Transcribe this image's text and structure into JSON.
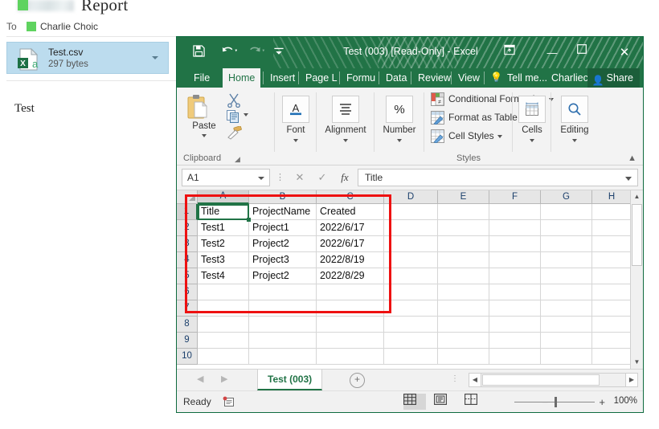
{
  "mail": {
    "subject": "Report",
    "to_label": "To",
    "recipient": "Charlie Choic",
    "attachment": {
      "name": "Test.csv",
      "size": "297 bytes",
      "icon": "excel-csv-file-icon"
    },
    "body": "Test"
  },
  "excel": {
    "title": "Test (003)  [Read-Only] - Excel",
    "quick_access": [
      {
        "name": "save",
        "glyph": "💾"
      },
      {
        "name": "undo",
        "glyph": "↶"
      },
      {
        "name": "redo",
        "glyph": "↷"
      },
      {
        "name": "customize-quick-access-toolbar",
        "glyph": "☰"
      }
    ],
    "window_buttons": {
      "ribbon_display": "⬛",
      "minimize": "—",
      "maximize": "☐",
      "close": "✕"
    },
    "tabs": [
      {
        "label": "File",
        "active": false
      },
      {
        "label": "Home",
        "active": true
      },
      {
        "label": "Insert",
        "active": false
      },
      {
        "label": "Page L",
        "active": false
      },
      {
        "label": "Formu",
        "active": false
      },
      {
        "label": "Data",
        "active": false
      },
      {
        "label": "Review",
        "active": false
      },
      {
        "label": "View",
        "active": false
      }
    ],
    "tell_me": "Tell me...",
    "user": "Charliech...",
    "share": "Share",
    "ribbon": {
      "groups": [
        {
          "name": "Clipboard",
          "label": "Clipboard"
        },
        {
          "name": "Font",
          "label": ""
        },
        {
          "name": "Alignment",
          "label": ""
        },
        {
          "name": "Number",
          "label": ""
        },
        {
          "name": "Styles",
          "label": "Styles"
        },
        {
          "name": "Cells",
          "label": ""
        },
        {
          "name": "Editing",
          "label": ""
        }
      ],
      "paste": "Paste",
      "cut_icon": "scissors-icon",
      "copy_icon": "copy-icon",
      "format_painter_icon": "format-painter-icon",
      "font": "Font",
      "alignment": "Alignment",
      "number": "Number",
      "number_symbol": "%",
      "font_symbol": "A",
      "styles": {
        "conditional_formatting": "Conditional Formatting",
        "format_as_table": "Format as Table",
        "cell_styles": "Cell Styles",
        "group_label": "Styles"
      },
      "cells": "Cells",
      "editing": "Editing",
      "collapse_icon": "chevron-up-icon"
    },
    "formula_bar": {
      "name_box": "A1",
      "cancel_icon": "✕",
      "enter_icon": "✓",
      "function_icon": "fx",
      "value": "Title"
    },
    "grid": {
      "columns": [
        "A",
        "B",
        "C",
        "D",
        "E",
        "F",
        "G",
        "H"
      ],
      "rows": [
        "1",
        "2",
        "3",
        "4",
        "5",
        "6",
        "7",
        "8",
        "9",
        "10"
      ],
      "selected_cell": "A1",
      "data": [
        [
          "Title",
          "ProjectName",
          "Created"
        ],
        [
          "Test1",
          "Project1",
          "2022/6/17"
        ],
        [
          "Test2",
          "Project2",
          "2022/6/17"
        ],
        [
          "Test3",
          "Project3",
          "2022/8/19"
        ],
        [
          "Test4",
          "Project2",
          "2022/8/29"
        ]
      ]
    },
    "sheet_tabs": {
      "first_arrow": "◀",
      "last_arrow": "▶",
      "tabs": [
        {
          "label": "Test (003)",
          "active": true
        }
      ],
      "add_label": "+"
    },
    "status_bar": {
      "status": "Ready",
      "macro_icon": "record-macro-icon",
      "views": [
        {
          "name": "normal-view",
          "glyph": "▦",
          "active": true
        },
        {
          "name": "page-layout-view",
          "glyph": "▤",
          "active": false
        },
        {
          "name": "page-break-preview",
          "glyph": "⌷",
          "active": false
        }
      ],
      "zoom_out": "−",
      "zoom_in": "+",
      "zoom_value": "100%"
    }
  },
  "annotation": {
    "name": "red-highlight-box",
    "color": "#ee1111"
  }
}
